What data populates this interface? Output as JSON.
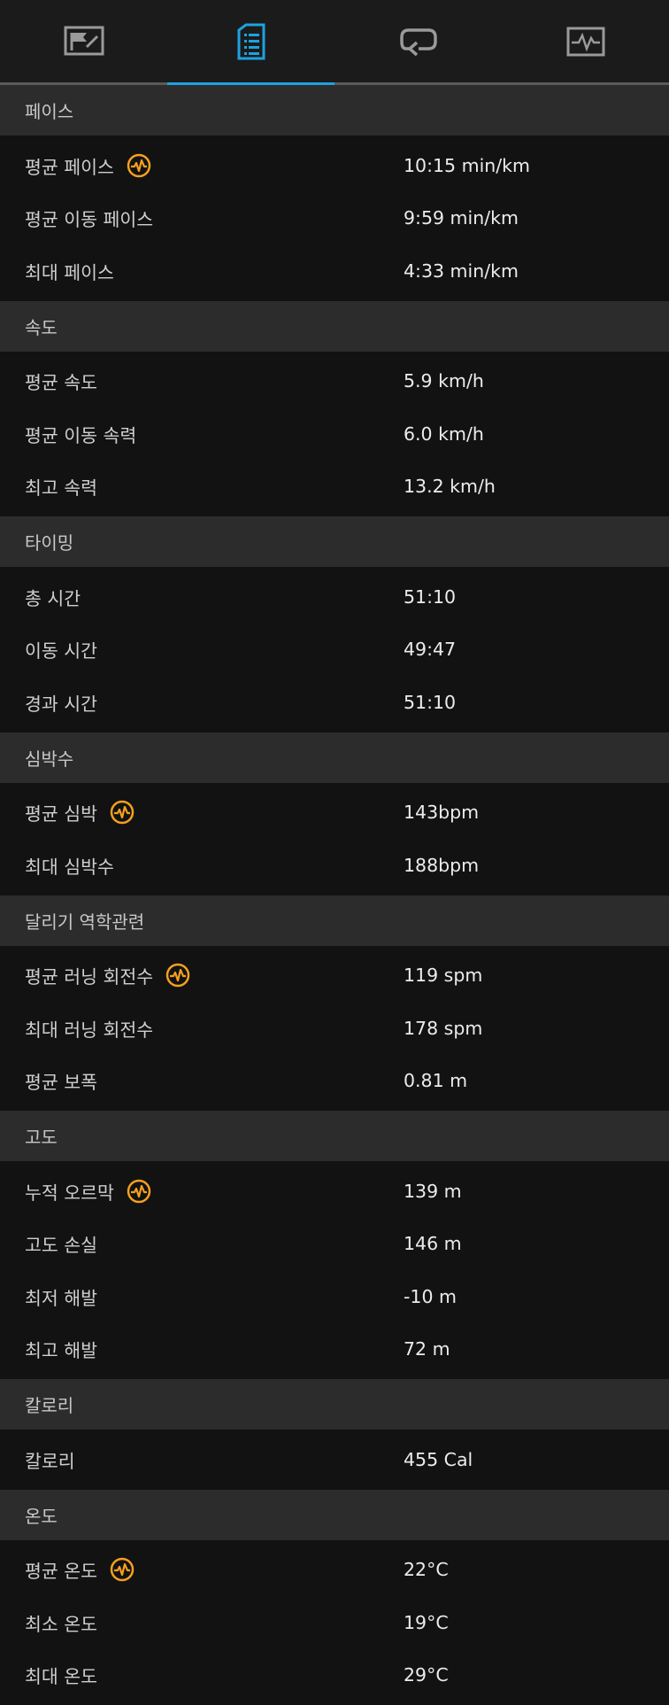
{
  "tabs": [
    {
      "icon": "map-flag-icon",
      "active": false
    },
    {
      "icon": "document-list-icon",
      "active": true
    },
    {
      "icon": "laps-loop-icon",
      "active": false
    },
    {
      "icon": "chart-monitor-icon",
      "active": false
    }
  ],
  "colors": {
    "accent": "#1ea2df",
    "badge": "#f5a01f",
    "header_bg": "#2c2c2c",
    "row_bg": "#121212"
  },
  "sections": [
    {
      "title": "페이스",
      "rows": [
        {
          "label": "평균 페이스",
          "value": "10:15 min/km",
          "badge": true
        },
        {
          "label": "평균 이동 페이스",
          "value": "9:59 min/km",
          "badge": false
        },
        {
          "label": "최대 페이스",
          "value": "4:33 min/km",
          "badge": false
        }
      ]
    },
    {
      "title": "속도",
      "rows": [
        {
          "label": "평균 속도",
          "value": "5.9 km/h",
          "badge": false
        },
        {
          "label": "평균 이동 속력",
          "value": "6.0 km/h",
          "badge": false
        },
        {
          "label": "최고 속력",
          "value": "13.2 km/h",
          "badge": false
        }
      ]
    },
    {
      "title": "타이밍",
      "rows": [
        {
          "label": "총 시간",
          "value": "51:10",
          "badge": false
        },
        {
          "label": "이동 시간",
          "value": "49:47",
          "badge": false
        },
        {
          "label": "경과 시간",
          "value": "51:10",
          "badge": false
        }
      ]
    },
    {
      "title": "심박수",
      "rows": [
        {
          "label": "평균 심박",
          "value": "143bpm",
          "badge": true
        },
        {
          "label": "최대 심박수",
          "value": "188bpm",
          "badge": false
        }
      ]
    },
    {
      "title": "달리기 역학관련",
      "rows": [
        {
          "label": "평균 러닝 회전수",
          "value": "119 spm",
          "badge": true
        },
        {
          "label": "최대 러닝 회전수",
          "value": "178 spm",
          "badge": false
        },
        {
          "label": "평균 보폭",
          "value": "0.81 m",
          "badge": false
        }
      ]
    },
    {
      "title": "고도",
      "rows": [
        {
          "label": "누적 오르막",
          "value": "139 m",
          "badge": true
        },
        {
          "label": "고도 손실",
          "value": "146 m",
          "badge": false
        },
        {
          "label": "최저 해발",
          "value": "-10 m",
          "badge": false
        },
        {
          "label": "최고 해발",
          "value": "72 m",
          "badge": false
        }
      ]
    },
    {
      "title": "칼로리",
      "rows": [
        {
          "label": "칼로리",
          "value": "455 Cal",
          "badge": false
        }
      ]
    },
    {
      "title": "온도",
      "rows": [
        {
          "label": "평균 온도",
          "value": "22°C",
          "badge": true
        },
        {
          "label": "최소 온도",
          "value": "19°C",
          "badge": false
        },
        {
          "label": "최대 온도",
          "value": "29°C",
          "badge": false
        }
      ]
    }
  ]
}
